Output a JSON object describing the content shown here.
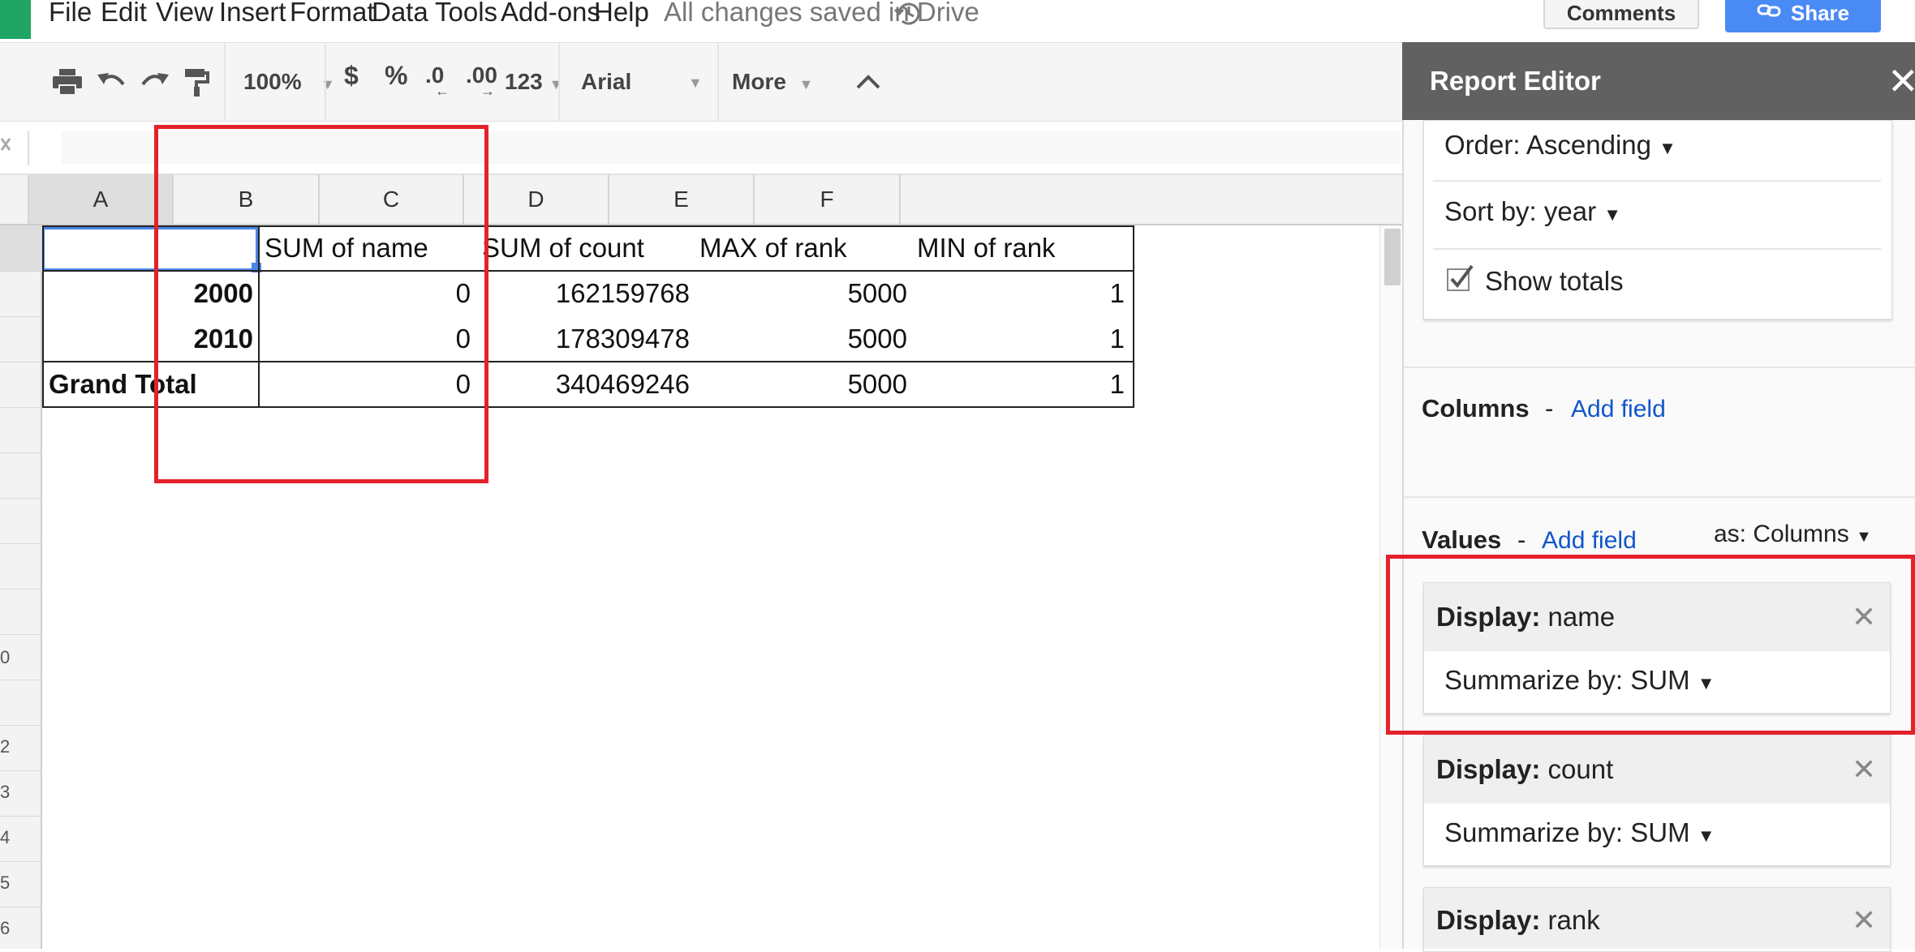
{
  "menu": {
    "items": [
      "File",
      "Edit",
      "View",
      "Insert",
      "Format",
      "Data",
      "Tools",
      "Add-ons",
      "Help"
    ],
    "status": "All changes saved in Drive",
    "comments_label": "Comments",
    "share_label": "Share"
  },
  "toolbar": {
    "zoom": "100%",
    "currency": "$",
    "percent": "%",
    "decimal_decrease": ".0",
    "decimal_increase": ".00",
    "number_format": "123",
    "font": "Arial",
    "more": "More"
  },
  "grid": {
    "columns": [
      "A",
      "B",
      "C",
      "D",
      "E",
      "F"
    ],
    "header_cells": [
      "",
      "SUM of name",
      "SUM of count",
      "MAX of rank",
      "MIN of rank"
    ],
    "rows": [
      {
        "label": "2000",
        "values": [
          "0",
          "162159768",
          "5000",
          "1"
        ]
      },
      {
        "label": "2010",
        "values": [
          "0",
          "178309478",
          "5000",
          "1"
        ]
      }
    ],
    "grand_total": {
      "label": "Grand Total",
      "values": [
        "0",
        "340469246",
        "5000",
        "1"
      ]
    },
    "row_numbers": [
      "0",
      "2",
      "3",
      "4",
      "5",
      "6"
    ]
  },
  "report_editor": {
    "title": "Report Editor",
    "order": "Order: Ascending",
    "sort_by": "Sort by: year",
    "show_totals": "Show totals",
    "columns_title": "Columns",
    "columns_add": "Add field",
    "values_title": "Values",
    "values_add": "Add field",
    "values_as": "as: Columns",
    "value_cards": [
      {
        "display_label": "Display:",
        "field": "name",
        "summarize": "Summarize by: SUM"
      },
      {
        "display_label": "Display:",
        "field": "count",
        "summarize": "Summarize by: SUM"
      },
      {
        "display_label": "Display:",
        "field": "rank"
      }
    ]
  },
  "colors": {
    "accent_green": "#1fa463",
    "share_blue": "#4a8af4",
    "link_blue": "#1155cc",
    "highlight_red": "#e3222a",
    "header_gray": "#616161"
  }
}
